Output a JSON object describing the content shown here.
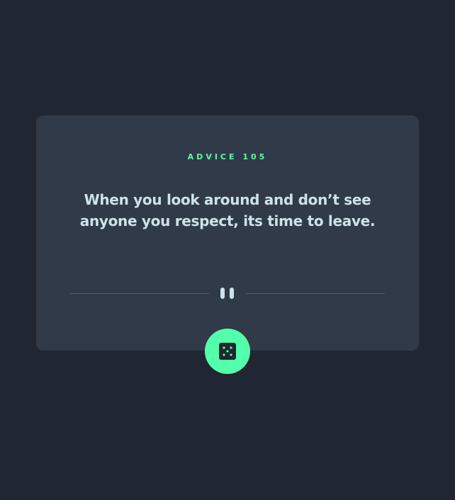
{
  "advice": {
    "label": "Advice",
    "number": "105",
    "quote": "When you look around and don’t see anyone you respect, its time to leave."
  },
  "colors": {
    "background": "#202632",
    "card": "#313a48",
    "accent": "#53ffaa",
    "text": "#cee3e9",
    "divider": "#4f5d74"
  },
  "icons": {
    "divider": "pause-icon",
    "button": "dice-icon"
  }
}
